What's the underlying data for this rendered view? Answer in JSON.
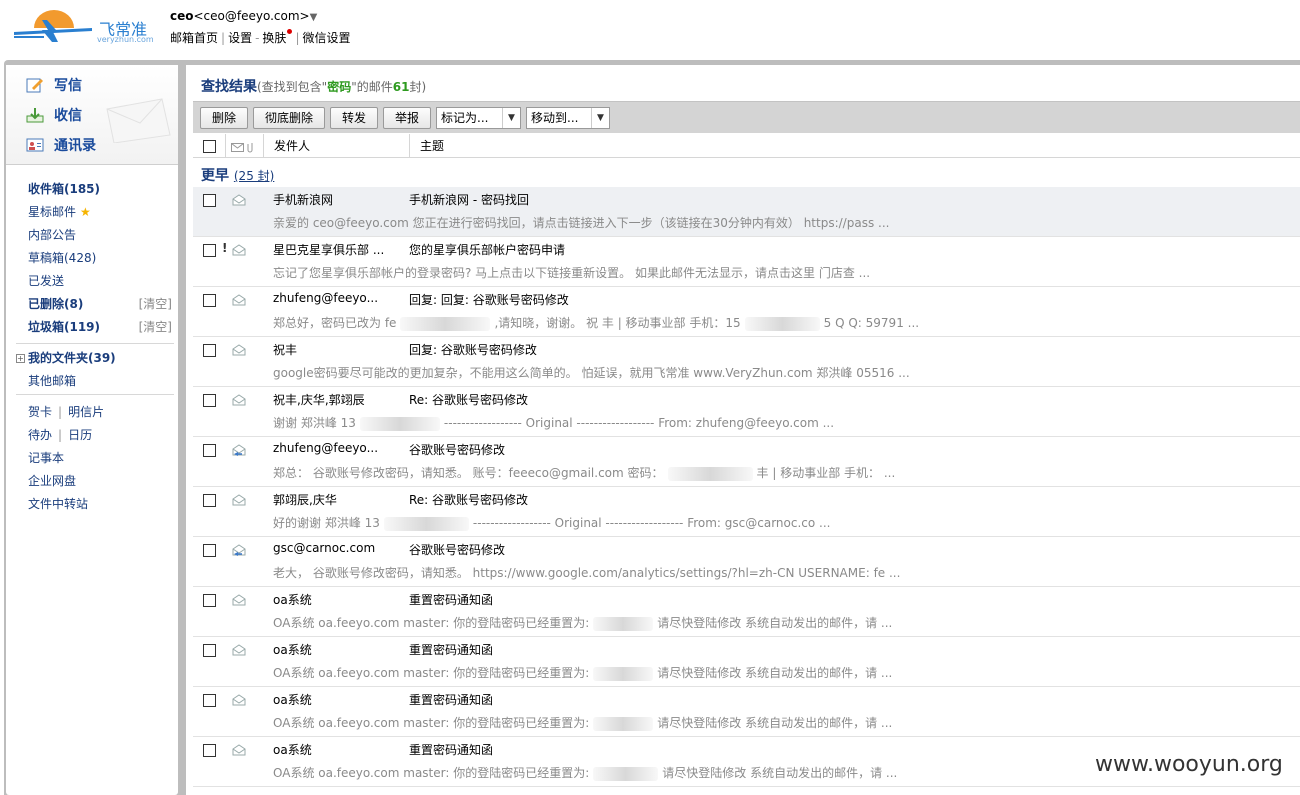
{
  "header": {
    "logo_text": "飞常准",
    "logo_sub": "veryzhun.com",
    "account_name": "ceo",
    "account_email": "<ceo@feeyo.com>",
    "nav": [
      "邮箱首页",
      "设置",
      "换肤",
      "微信设置"
    ]
  },
  "sidebar": {
    "compose": "写信",
    "inbox_check": "收信",
    "contacts": "通讯录",
    "folders": [
      {
        "label": "收件箱(185)",
        "bold": true
      },
      {
        "label": "星标邮件",
        "star": true
      },
      {
        "label": "内部公告"
      },
      {
        "label": "草稿箱(428)"
      },
      {
        "label": "已发送"
      },
      {
        "label": "已删除(8)",
        "bold": true,
        "clear": "[清空]"
      },
      {
        "label": "垃圾箱(119)",
        "bold": true,
        "clear": "[清空]"
      }
    ],
    "my_folders": "我的文件夹(39)",
    "other_mailbox": "其他邮箱",
    "tools": [
      [
        "贺卡",
        "明信片"
      ],
      [
        "待办",
        "日历"
      ],
      [
        "记事本"
      ],
      [
        "企业网盘"
      ],
      [
        "文件中转站"
      ]
    ]
  },
  "main": {
    "title": "查找结果",
    "title_pre": "(查找到包含\"",
    "keyword": "密码",
    "title_mid": "\"的邮件",
    "count": "61",
    "title_post": "封)",
    "toolbar": {
      "delete": "删除",
      "purge": "彻底删除",
      "forward": "转发",
      "report": "举报",
      "mark_as": "标记为...",
      "move_to": "移动到..."
    },
    "columns": {
      "from": "发件人",
      "subject": "主题"
    },
    "group_label": "更早",
    "group_count": "(25 封)",
    "rows": [
      {
        "from": "手机新浪网",
        "subject": "手机新浪网 - 密码找回",
        "preview": "亲爱的 ceo@feeyo.com 您正在进行密码找回，请点击链接进入下一步（该链接在30分钟内有效） https://pass ...",
        "highlight": true
      },
      {
        "from": "星巴克星享俱乐部 ...",
        "subject": "您的星享俱乐部帐户密码申请",
        "preview": "忘记了您星享俱乐部帐户的登录密码? 马上点击以下链接重新设置。 如果此邮件无法显示，请点击这里 门店查 ...",
        "flag": "!"
      },
      {
        "from": "zhufeng@feeyo...",
        "subject": "回复: 回复: 谷歌账号密码修改",
        "preview_a": "郑总好，密码已改为 fe",
        "preview_b": ",请知晓，谢谢。 祝 丰 | 移动事业部 手机：15",
        "preview_c": "5 Q Q:  59791 ..."
      },
      {
        "from": "祝丰",
        "subject": "回复: 谷歌账号密码修改",
        "preview": "google密码要尽可能改的更加复杂，不能用这么简单的。 怕延误，就用飞常准 www.VeryZhun.com 郑洪峰 05516 ..."
      },
      {
        "from": "祝丰,庆华,郭翊辰",
        "subject": "Re: 谷歌账号密码修改",
        "preview_a": "谢谢  郑洪峰 13",
        "preview_b": "------------------ Original ------------------ From: zhufeng@feeyo.com ..."
      },
      {
        "from": "zhufeng@feeyo...",
        "subject": "谷歌账号密码修改",
        "preview_a": "郑总：  谷歌账号修改密码，请知悉。 账号：feeeco@gmail.com 密码：",
        "preview_b": "丰 | 移动事业部 手机：  ...",
        "replied": true
      },
      {
        "from": "郭翊辰,庆华",
        "subject": "Re: 谷歌账号密码修改",
        "preview_a": "好的谢谢  郑洪峰 13",
        "preview_b": "------------------ Original ------------------ From: gsc@carnoc.co ..."
      },
      {
        "from": "gsc@carnoc.com",
        "subject": "谷歌账号密码修改",
        "preview": "老大，  谷歌账号修改密码，请知悉。 https://www.google.com/analytics/settings/?hl=zh-CN USERNAME:  fe ...",
        "replied": true
      },
      {
        "from": "oa系统",
        "subject": "重置密码通知函",
        "preview_a": "OA系统 oa.feeyo.com master:  你的登陆密码已经重置为:",
        "preview_b": "请尽快登陆修改 系统自动发出的邮件，请 ..."
      },
      {
        "from": "oa系统",
        "subject": "重置密码通知函",
        "preview_a": "OA系统 oa.feeyo.com master:  你的登陆密码已经重置为:",
        "preview_b": "请尽快登陆修改 系统自动发出的邮件，请 ..."
      },
      {
        "from": "oa系统",
        "subject": "重置密码通知函",
        "preview_a": "OA系统 oa.feeyo.com master:  你的登陆密码已经重置为:",
        "preview_b": "请尽快登陆修改 系统自动发出的邮件，请 ..."
      },
      {
        "from": "oa系统",
        "subject": "重置密码通知函",
        "preview_a": "OA系统 oa.feeyo.com master:  你的登陆密码已经重置为:",
        "preview_b": "请尽快登陆修改 系统自动发出的邮件，请 ..."
      }
    ]
  },
  "watermark": "www.wooyun.org"
}
